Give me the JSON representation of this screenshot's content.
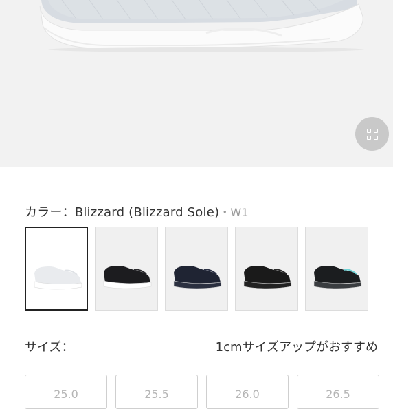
{
  "gallery": {
    "icon": "grid-icon"
  },
  "color_section": {
    "label": "カラー：",
    "selected_name": "Blizzard (Blizzard Sole)",
    "code": "・W1",
    "swatches": [
      {
        "upper": "#e9ebee",
        "sole": "#ffffff",
        "accent": "#dfe2e6"
      },
      {
        "upper": "#1c1c1f",
        "sole": "#ffffff",
        "accent": "#2a2a2e"
      },
      {
        "upper": "#1f2433",
        "sole": "#2b3040",
        "accent": "#2a3044"
      },
      {
        "upper": "#1a1a1a",
        "sole": "#222222",
        "accent": "#2a2a2a"
      },
      {
        "upper": "#1b1d1f",
        "sole": "#3a3d40",
        "accent": "#6fd3d6"
      }
    ]
  },
  "size_section": {
    "label": "サイズ：",
    "recommendation": "1cmサイズアップがおすすめ",
    "options": [
      "25.0",
      "25.5",
      "26.0",
      "26.5"
    ]
  },
  "colors": {
    "hero_bg": "#f2f2f2",
    "selected_border": "#222222"
  }
}
